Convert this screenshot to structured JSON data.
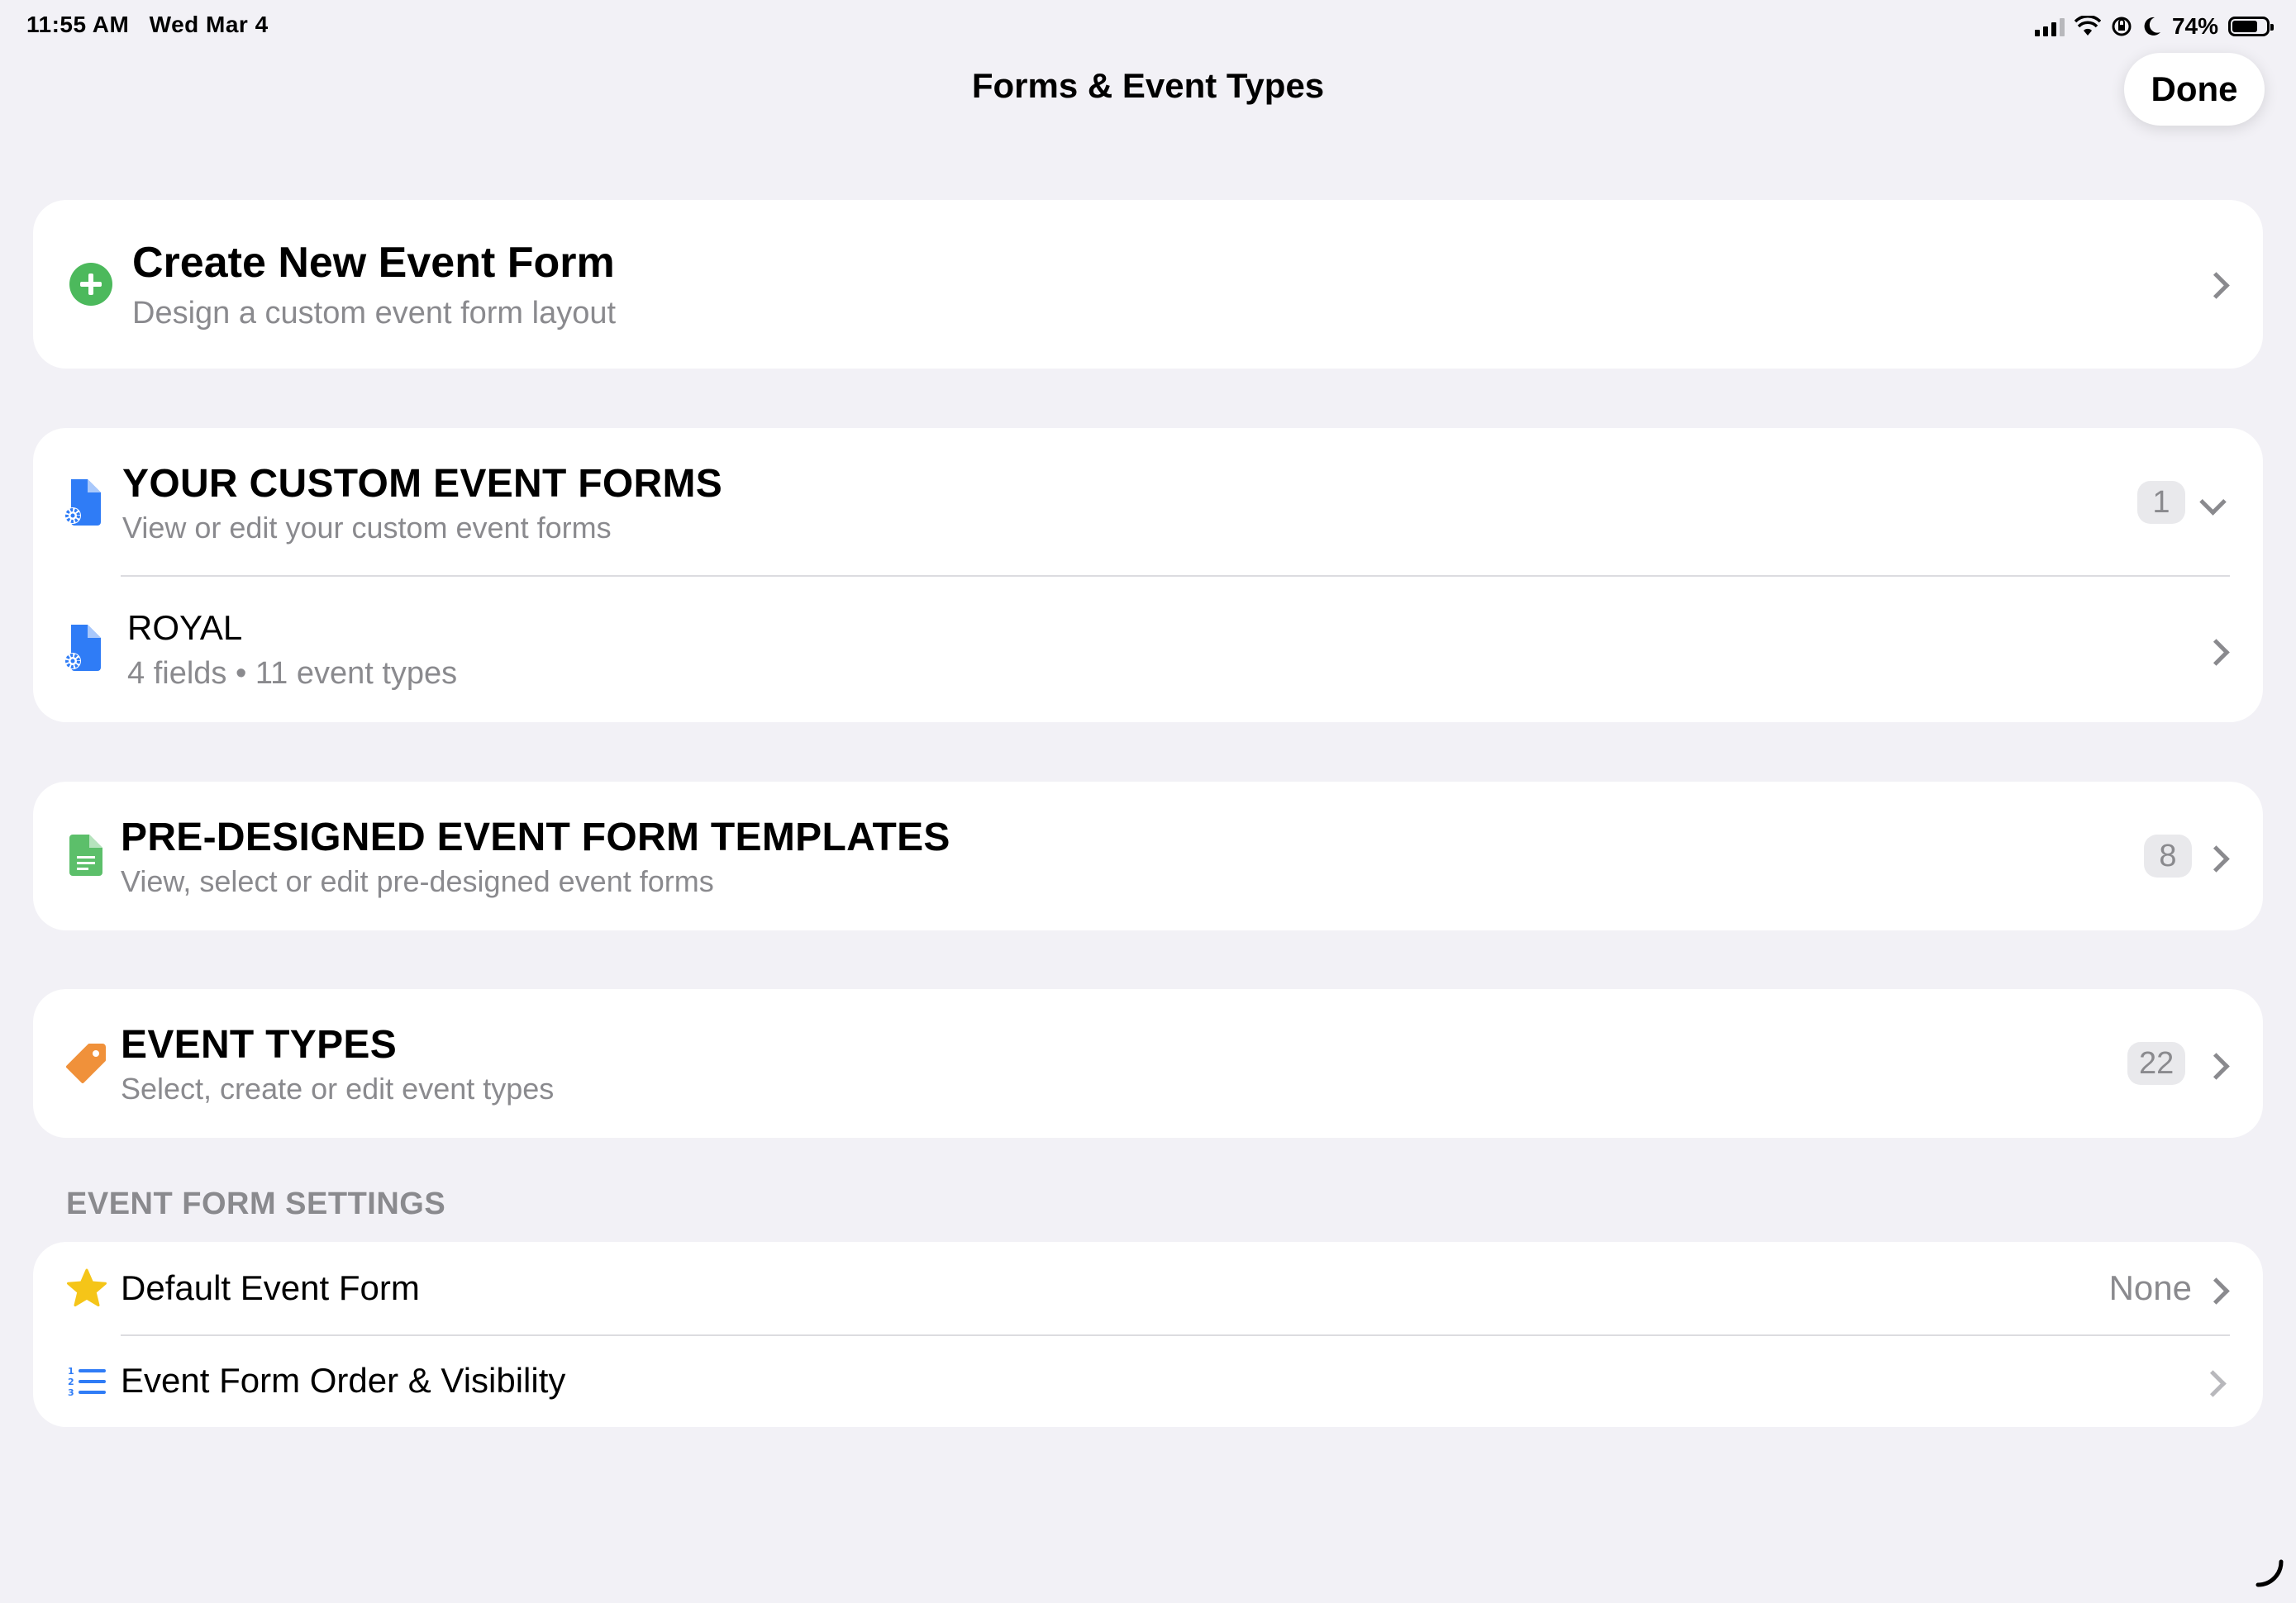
{
  "status_bar": {
    "time": "11:55 AM",
    "date": "Wed Mar 4",
    "battery": "74%"
  },
  "nav": {
    "title": "Forms & Event Types",
    "done_label": "Done"
  },
  "create_card": {
    "title": "Create New Event Form",
    "subtitle": "Design a custom event form layout",
    "icon": "plus-circle-icon",
    "icon_color": "#4cb95c"
  },
  "custom_forms": {
    "title": "YOUR CUSTOM EVENT FORMS",
    "subtitle": "View or edit your custom event forms",
    "count": "1",
    "icon_color": "#2f7cf6",
    "items": [
      {
        "title": "ROYAL",
        "subtitle": "4 fields • 11 event types"
      }
    ]
  },
  "templates": {
    "title": "PRE-DESIGNED EVENT FORM TEMPLATES",
    "subtitle": "View, select or edit pre-designed event forms",
    "count": "8",
    "icon_color": "#5cbf6a"
  },
  "event_types": {
    "title": "EVENT TYPES",
    "subtitle": "Select, create or edit event types",
    "count": "22",
    "icon_color": "#f0913a"
  },
  "settings": {
    "header": "EVENT FORM SETTINGS",
    "default_form": {
      "label": "Default Event Form",
      "value": "None",
      "icon_color": "#f5c518"
    },
    "order_visibility": {
      "label": "Event Form Order & Visibility",
      "icon_color": "#2f7cf6"
    }
  }
}
